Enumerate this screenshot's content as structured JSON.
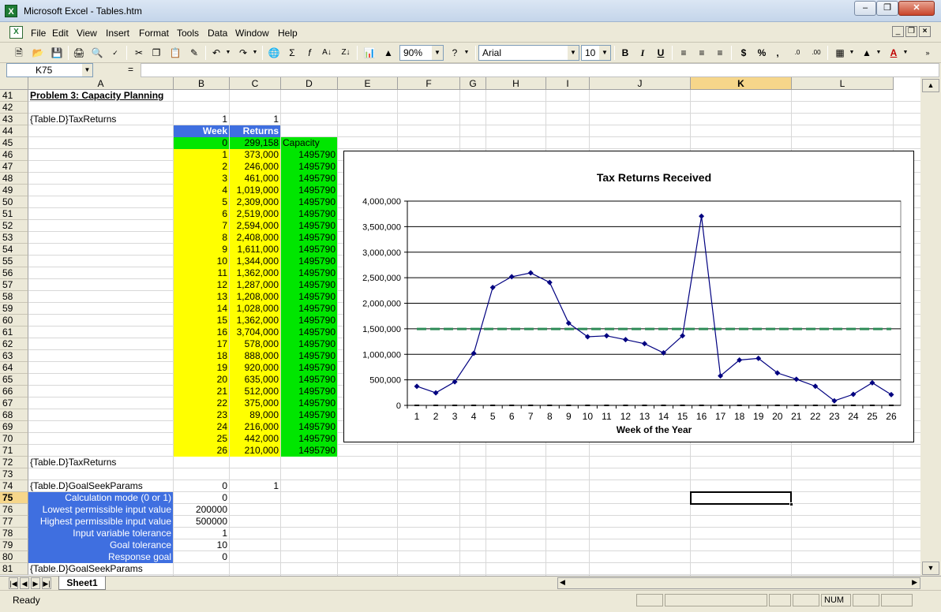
{
  "window": {
    "title": "Microsoft Excel - Tables.htm"
  },
  "menu": [
    "File",
    "Edit",
    "View",
    "Insert",
    "Format",
    "Tools",
    "Data",
    "Window",
    "Help"
  ],
  "toolbar": {
    "zoom": "90%",
    "font": "Arial",
    "font_size": "10"
  },
  "formula_bar": {
    "name_box": "K75",
    "equals": "=",
    "formula": ""
  },
  "columns": [
    "A",
    "B",
    "C",
    "D",
    "E",
    "F",
    "G",
    "H",
    "I",
    "J",
    "K",
    "L"
  ],
  "rows": [
    "41",
    "42",
    "43",
    "44",
    "45",
    "46",
    "47",
    "48",
    "49",
    "50",
    "51",
    "52",
    "53",
    "54",
    "55",
    "56",
    "57",
    "58",
    "59",
    "60",
    "61",
    "62",
    "63",
    "64",
    "65",
    "66",
    "67",
    "68",
    "69",
    "70",
    "71",
    "72",
    "73",
    "74",
    "75",
    "76",
    "77",
    "78",
    "79",
    "80",
    "81"
  ],
  "cells": {
    "a41": "Problem 3: Capacity Planning",
    "a43": "{Table.D}TaxReturns",
    "b43": "1",
    "c43": "1",
    "b44": "Week",
    "c44": "Returns",
    "b45": "0",
    "c45": "299,158",
    "d45": "Capacity",
    "a72": "{Table.D}TaxReturns",
    "a74": "{Table.D}GoalSeekParams",
    "b74": "0",
    "c74": "1",
    "a81": "{Table.D}GoalSeekParams"
  },
  "table": {
    "weeks": [
      "1",
      "2",
      "3",
      "4",
      "5",
      "6",
      "7",
      "8",
      "9",
      "10",
      "11",
      "12",
      "13",
      "14",
      "15",
      "16",
      "17",
      "18",
      "19",
      "20",
      "21",
      "22",
      "23",
      "24",
      "25",
      "26"
    ],
    "returns": [
      "373,000",
      "246,000",
      "461,000",
      "1,019,000",
      "2,309,000",
      "2,519,000",
      "2,594,000",
      "2,408,000",
      "1,611,000",
      "1,344,000",
      "1,362,000",
      "1,287,000",
      "1,208,000",
      "1,028,000",
      "1,362,000",
      "3,704,000",
      "578,000",
      "888,000",
      "920,000",
      "635,000",
      "512,000",
      "375,000",
      "89,000",
      "216,000",
      "442,000",
      "210,000"
    ],
    "capacity": "1495790"
  },
  "params": [
    {
      "label": "Calculation mode (0 or 1)",
      "value": "0"
    },
    {
      "label": "Lowest permissible input value",
      "value": "200000"
    },
    {
      "label": "Highest permissible input value",
      "value": "500000"
    },
    {
      "label": "Input variable tolerance",
      "value": "1"
    },
    {
      "label": "Goal tolerance",
      "value": "10"
    },
    {
      "label": "Response goal",
      "value": "0"
    }
  ],
  "chart_data": {
    "type": "line",
    "title": "Tax Returns Received",
    "xlabel": "Week of the Year",
    "ylabel": "",
    "categories": [
      "1",
      "2",
      "3",
      "4",
      "5",
      "6",
      "7",
      "8",
      "9",
      "10",
      "11",
      "12",
      "13",
      "14",
      "15",
      "16",
      "17",
      "18",
      "19",
      "20",
      "21",
      "22",
      "23",
      "24",
      "25",
      "26"
    ],
    "series": [
      {
        "values": [
          373000,
          246000,
          461000,
          1019000,
          2309000,
          2519000,
          2594000,
          2408000,
          1611000,
          1344000,
          1362000,
          1287000,
          1208000,
          1028000,
          1362000,
          3704000,
          578000,
          888000,
          920000,
          635000,
          512000,
          375000,
          89000,
          216000,
          442000,
          210000
        ],
        "color": "#000080",
        "style": "line-diamond"
      },
      {
        "values": [
          1495790,
          1495790,
          1495790,
          1495790,
          1495790,
          1495790,
          1495790,
          1495790,
          1495790,
          1495790,
          1495790,
          1495790,
          1495790,
          1495790,
          1495790,
          1495790,
          1495790,
          1495790,
          1495790,
          1495790,
          1495790,
          1495790,
          1495790,
          1495790,
          1495790,
          1495790
        ],
        "color": "#2e8b57",
        "style": "dashed"
      },
      {
        "values": [
          0,
          0,
          0,
          0,
          0,
          0,
          0,
          0,
          0,
          0,
          0,
          0,
          0,
          0,
          0,
          0,
          0,
          0,
          0,
          0,
          0,
          0,
          0,
          0,
          0,
          0
        ],
        "color": "#000000",
        "style": "marker-only"
      }
    ],
    "yticks": [
      "0",
      "500,000",
      "1,000,000",
      "1,500,000",
      "2,000,000",
      "2,500,000",
      "3,000,000",
      "3,500,000",
      "4,000,000"
    ],
    "ylim": [
      0,
      4000000
    ],
    "grid": true,
    "legend": "none"
  },
  "tabs": {
    "sheet": "Sheet1"
  },
  "status": {
    "ready": "Ready",
    "num": "NUM"
  },
  "colors": {
    "header_blue": "#3f6fe0",
    "week_yellow": "#ffff00",
    "capacity_green": "#00e600",
    "series_navy": "#000080",
    "capacity_line": "#2e8b57"
  }
}
